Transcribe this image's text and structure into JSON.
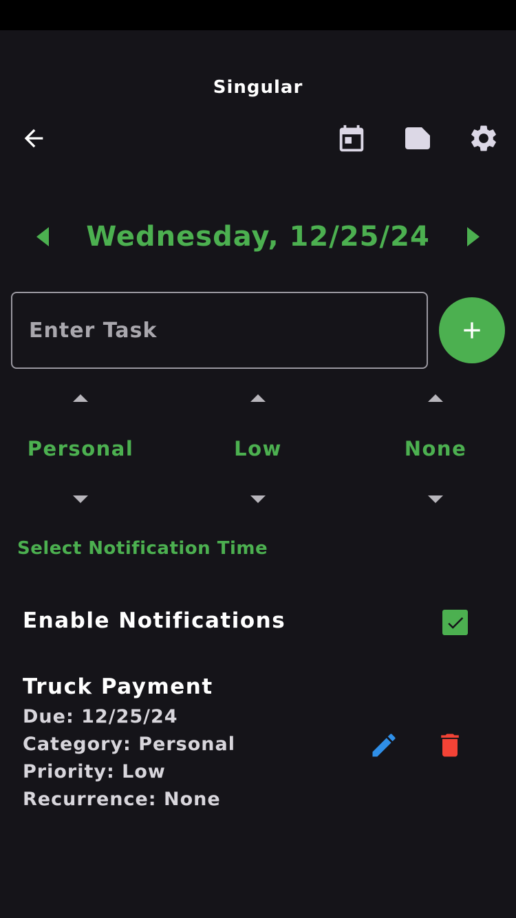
{
  "app": {
    "title": "Singular"
  },
  "toolbar": {
    "back_icon": "arrow-back-icon",
    "calendar_icon": "calendar-icon",
    "note_icon": "note-icon",
    "settings_icon": "gear-icon"
  },
  "date_nav": {
    "label": "Wednesday, 12/25/24",
    "prev_icon": "caret-left-icon",
    "next_icon": "caret-right-icon"
  },
  "task_input": {
    "value": "",
    "placeholder": "Enter Task"
  },
  "add_button": {
    "icon": "plus-icon"
  },
  "pickers": {
    "category": "Personal",
    "priority": "Low",
    "recurrence": "None"
  },
  "notification": {
    "select_time_label": "Select Notification Time",
    "enable_label": "Enable Notifications",
    "enabled": true
  },
  "tasks": [
    {
      "title": "Truck Payment",
      "due": "Due: 12/25/24",
      "category": "Category: Personal",
      "priority": "Priority: Low",
      "recurrence": "Recurrence: None"
    }
  ],
  "colors": {
    "background": "#151419",
    "accent": "#4cb050",
    "edit": "#2f8fe8",
    "delete": "#f44336",
    "icon_light": "#dcd8e6"
  }
}
